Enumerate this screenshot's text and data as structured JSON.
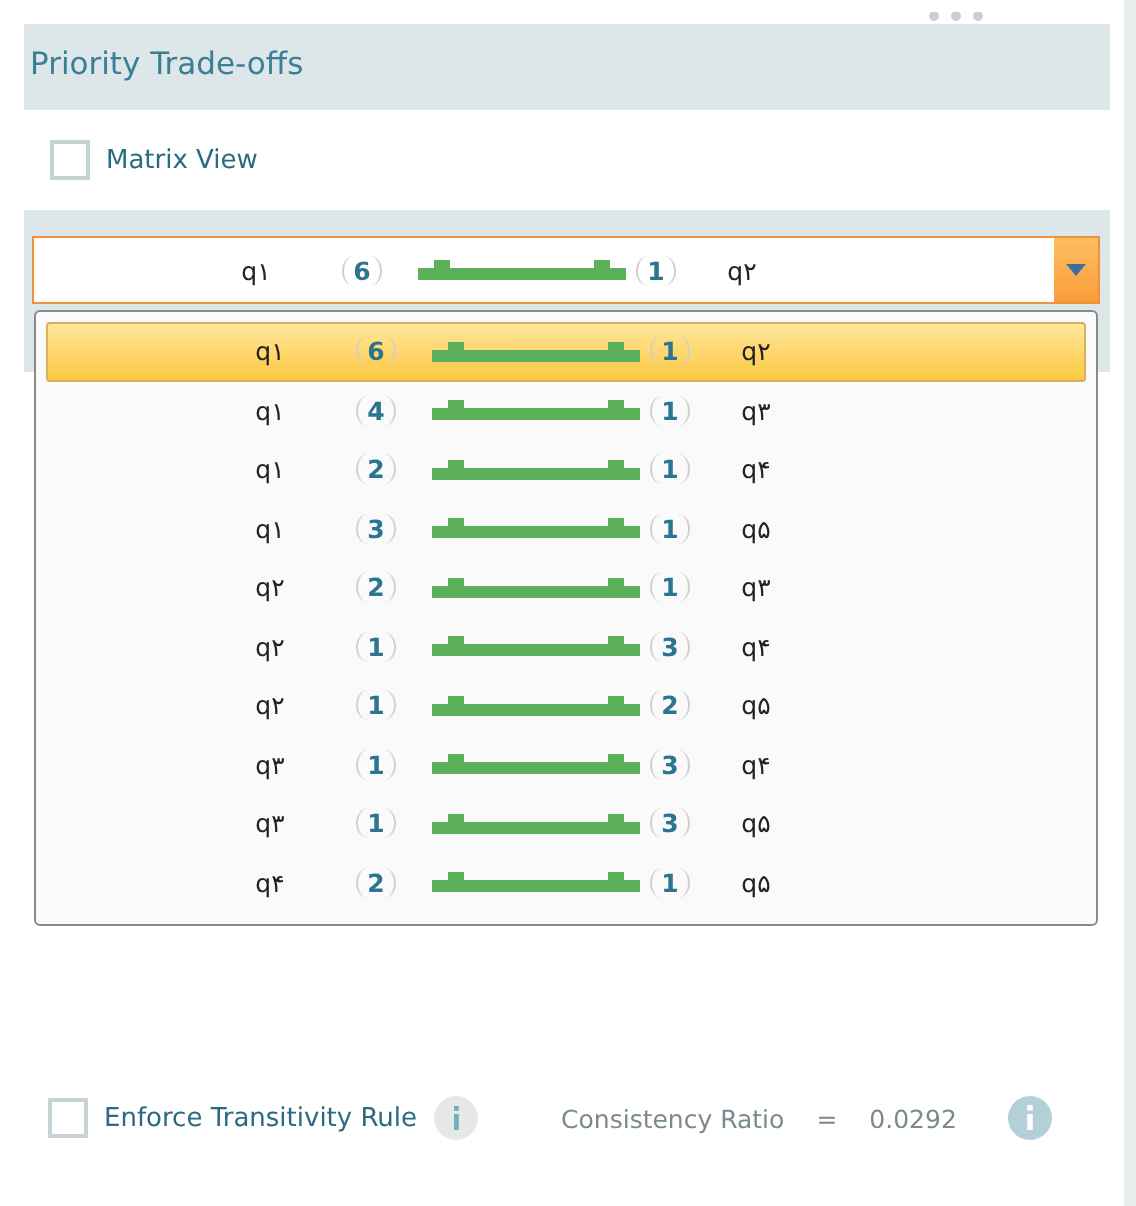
{
  "panel": {
    "title": "Priority Trade-offs"
  },
  "matrix_view": {
    "label": "Matrix View",
    "checked": false
  },
  "combo": {
    "left": "q۱",
    "left_weight": "6",
    "right_weight": "1",
    "right": "q۲"
  },
  "options": [
    {
      "left": "q۱",
      "left_weight": "6",
      "right_weight": "1",
      "right": "q۲",
      "selected": true
    },
    {
      "left": "q۱",
      "left_weight": "4",
      "right_weight": "1",
      "right": "q۳",
      "selected": false
    },
    {
      "left": "q۱",
      "left_weight": "2",
      "right_weight": "1",
      "right": "q۴",
      "selected": false
    },
    {
      "left": "q۱",
      "left_weight": "3",
      "right_weight": "1",
      "right": "q۵",
      "selected": false
    },
    {
      "left": "q۲",
      "left_weight": "2",
      "right_weight": "1",
      "right": "q۳",
      "selected": false
    },
    {
      "left": "q۲",
      "left_weight": "1",
      "right_weight": "3",
      "right": "q۴",
      "selected": false
    },
    {
      "left": "q۲",
      "left_weight": "1",
      "right_weight": "2",
      "right": "q۵",
      "selected": false
    },
    {
      "left": "q۳",
      "left_weight": "1",
      "right_weight": "3",
      "right": "q۴",
      "selected": false
    },
    {
      "left": "q۳",
      "left_weight": "1",
      "right_weight": "3",
      "right": "q۵",
      "selected": false
    },
    {
      "left": "q۴",
      "left_weight": "2",
      "right_weight": "1",
      "right": "q۵",
      "selected": false
    }
  ],
  "transitivity": {
    "label": "Enforce Transitivity Rule",
    "checked": false
  },
  "consistency": {
    "label": "Consistency Ratio",
    "equals": "=",
    "value": "0.0292"
  }
}
